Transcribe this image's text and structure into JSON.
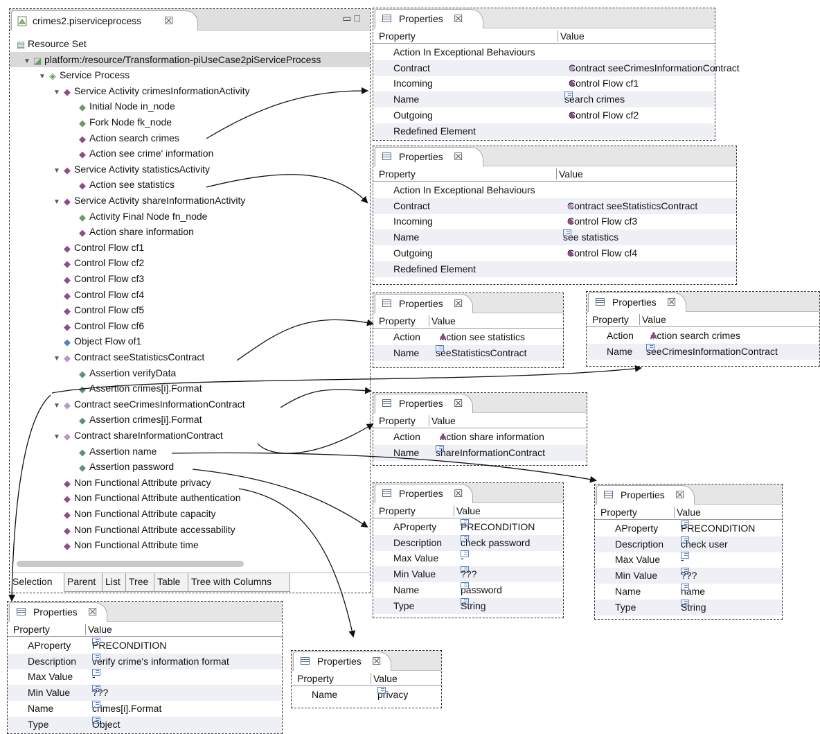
{
  "editor": {
    "tab_title": "crimes2.piserviceprocess",
    "tree": [
      {
        "label": "Resource Set",
        "icon": "resource-set-icon"
      },
      {
        "label": "platform:/resource/Transformation-piUseCase2piServiceProcess",
        "icon": "model-file-icon"
      },
      {
        "label": "Service Process",
        "icon": "service-process-icon"
      },
      {
        "label": "Service Activity crimesInformationActivity",
        "icon": "activity-icon"
      },
      {
        "label": "Initial Node in_node",
        "icon": "node-icon"
      },
      {
        "label": "Fork Node fk_node",
        "icon": "node-icon"
      },
      {
        "label": "Action search crimes",
        "icon": "action-icon"
      },
      {
        "label": "Action see crime' information",
        "icon": "action-icon"
      },
      {
        "label": "Service Activity statisticsActivity",
        "icon": "activity-icon"
      },
      {
        "label": "Action see statistics",
        "icon": "action-icon"
      },
      {
        "label": "Service Activity shareInformationActivity",
        "icon": "activity-icon"
      },
      {
        "label": "Activity Final Node fn_node",
        "icon": "node-icon"
      },
      {
        "label": "Action share information",
        "icon": "action-icon"
      },
      {
        "label": "Control Flow cf1",
        "icon": "control-flow-icon"
      },
      {
        "label": "Control Flow cf2",
        "icon": "control-flow-icon"
      },
      {
        "label": "Control Flow cf3",
        "icon": "control-flow-icon"
      },
      {
        "label": "Control Flow cf4",
        "icon": "control-flow-icon"
      },
      {
        "label": "Control Flow cf5",
        "icon": "control-flow-icon"
      },
      {
        "label": "Control Flow cf6",
        "icon": "control-flow-icon"
      },
      {
        "label": "Object Flow of1",
        "icon": "object-flow-icon"
      },
      {
        "label": "Contract seeStatisticsContract",
        "icon": "contract-icon"
      },
      {
        "label": "Assertion verifyData",
        "icon": "assertion-icon"
      },
      {
        "label": "Assertion crimes[i].Format",
        "icon": "assertion-icon"
      },
      {
        "label": "Contract seeCrimesInformationContract",
        "icon": "contract-icon"
      },
      {
        "label": "Assertion crimes[i].Format",
        "icon": "assertion-icon"
      },
      {
        "label": "Contract shareInformationContract",
        "icon": "contract-icon"
      },
      {
        "label": "Assertion name",
        "icon": "assertion-icon"
      },
      {
        "label": "Assertion password",
        "icon": "assertion-icon"
      },
      {
        "label": "Non Functional Attribute privacy",
        "icon": "nfa-icon"
      },
      {
        "label": "Non Functional Attribute authentication",
        "icon": "nfa-icon"
      },
      {
        "label": "Non Functional Attribute capacity",
        "icon": "nfa-icon"
      },
      {
        "label": "Non Functional Attribute accessability",
        "icon": "nfa-icon"
      },
      {
        "label": "Non Functional Attribute time",
        "icon": "nfa-icon"
      }
    ],
    "bottom_tabs": [
      "Selection",
      "Parent",
      "List",
      "Tree",
      "Table",
      "Tree with Columns"
    ]
  },
  "panels": [
    {
      "title": "Properties",
      "col_property": "Property",
      "col_value": "Value",
      "rows": [
        {
          "p": "Action In Exceptional Behaviours",
          "v": "",
          "icon": ""
        },
        {
          "p": "Contract",
          "v": "Contract seeCrimesInformationContract",
          "icon": "contract-icon"
        },
        {
          "p": "Incoming",
          "v": "Control Flow cf1",
          "icon": "control-flow-icon"
        },
        {
          "p": "Name",
          "v": "search crimes",
          "icon": "text-value-icon"
        },
        {
          "p": "Outgoing",
          "v": "Control Flow cf2",
          "icon": "control-flow-icon"
        },
        {
          "p": "Redefined Element",
          "v": "",
          "icon": ""
        }
      ]
    },
    {
      "title": "Properties",
      "col_property": "Property",
      "col_value": "Value",
      "rows": [
        {
          "p": "Action In Exceptional Behaviours",
          "v": "",
          "icon": ""
        },
        {
          "p": "Contract",
          "v": "Contract seeStatisticsContract",
          "icon": "contract-icon"
        },
        {
          "p": "Incoming",
          "v": "Control Flow cf3",
          "icon": "control-flow-icon"
        },
        {
          "p": "Name",
          "v": "see statistics",
          "icon": "text-value-icon"
        },
        {
          "p": "Outgoing",
          "v": "Control Flow cf4",
          "icon": "control-flow-icon"
        },
        {
          "p": "Redefined Element",
          "v": "",
          "icon": ""
        }
      ]
    },
    {
      "title": "Properties",
      "col_property": "Property",
      "col_value": "Value",
      "rows": [
        {
          "p": "Action",
          "v": "Action see statistics",
          "icon": "action-icon"
        },
        {
          "p": "Name",
          "v": "seeStatisticsContract",
          "icon": "text-value-icon"
        }
      ]
    },
    {
      "title": "Properties",
      "col_property": "Property",
      "col_value": "Value",
      "rows": [
        {
          "p": "Action",
          "v": "Action search crimes",
          "icon": "action-icon"
        },
        {
          "p": "Name",
          "v": "seeCrimesInformationContract",
          "icon": "text-value-icon"
        }
      ]
    },
    {
      "title": "Properties",
      "col_property": "Property",
      "col_value": "Value",
      "rows": [
        {
          "p": "Action",
          "v": "Action share information",
          "icon": "action-icon"
        },
        {
          "p": "Name",
          "v": "shareInformationContract",
          "icon": "text-value-icon"
        }
      ]
    },
    {
      "title": "Properties",
      "col_property": "Property",
      "col_value": "Value",
      "rows": [
        {
          "p": "AProperty",
          "v": "PRECONDITION",
          "icon": "text-value-icon"
        },
        {
          "p": "Description",
          "v": "check password",
          "icon": "text-value-icon"
        },
        {
          "p": "Max Value",
          "v": "-",
          "icon": "text-value-icon"
        },
        {
          "p": "Min Value",
          "v": "???",
          "icon": "text-value-icon"
        },
        {
          "p": "Name",
          "v": "password",
          "icon": "text-value-icon"
        },
        {
          "p": "Type",
          "v": "String",
          "icon": "text-value-icon"
        }
      ]
    },
    {
      "title": "Properties",
      "col_property": "Property",
      "col_value": "Value",
      "rows": [
        {
          "p": "AProperty",
          "v": "PRECONDITION",
          "icon": "text-value-icon"
        },
        {
          "p": "Description",
          "v": "check user",
          "icon": "text-value-icon"
        },
        {
          "p": "Max Value",
          "v": "-",
          "icon": "text-value-icon"
        },
        {
          "p": "Min Value",
          "v": "???",
          "icon": "text-value-icon"
        },
        {
          "p": "Name",
          "v": "name",
          "icon": "text-value-icon"
        },
        {
          "p": "Type",
          "v": "String",
          "icon": "text-value-icon"
        }
      ]
    },
    {
      "title": "Properties",
      "col_property": "Property",
      "col_value": "Value",
      "rows": [
        {
          "p": "AProperty",
          "v": "PRECONDITION",
          "icon": "text-value-icon"
        },
        {
          "p": "Description",
          "v": "verify crime's information format",
          "icon": "text-value-icon"
        },
        {
          "p": "Max Value",
          "v": "-",
          "icon": "text-value-icon"
        },
        {
          "p": "Min Value",
          "v": "???",
          "icon": "text-value-icon"
        },
        {
          "p": "Name",
          "v": "crimes[i].Format",
          "icon": "text-value-icon"
        },
        {
          "p": "Type",
          "v": "Object",
          "icon": "text-value-icon"
        }
      ]
    },
    {
      "title": "Properties",
      "col_property": "Property",
      "col_value": "Value",
      "rows": [
        {
          "p": "Name",
          "v": "privacy",
          "icon": "text-value-icon"
        }
      ]
    }
  ]
}
